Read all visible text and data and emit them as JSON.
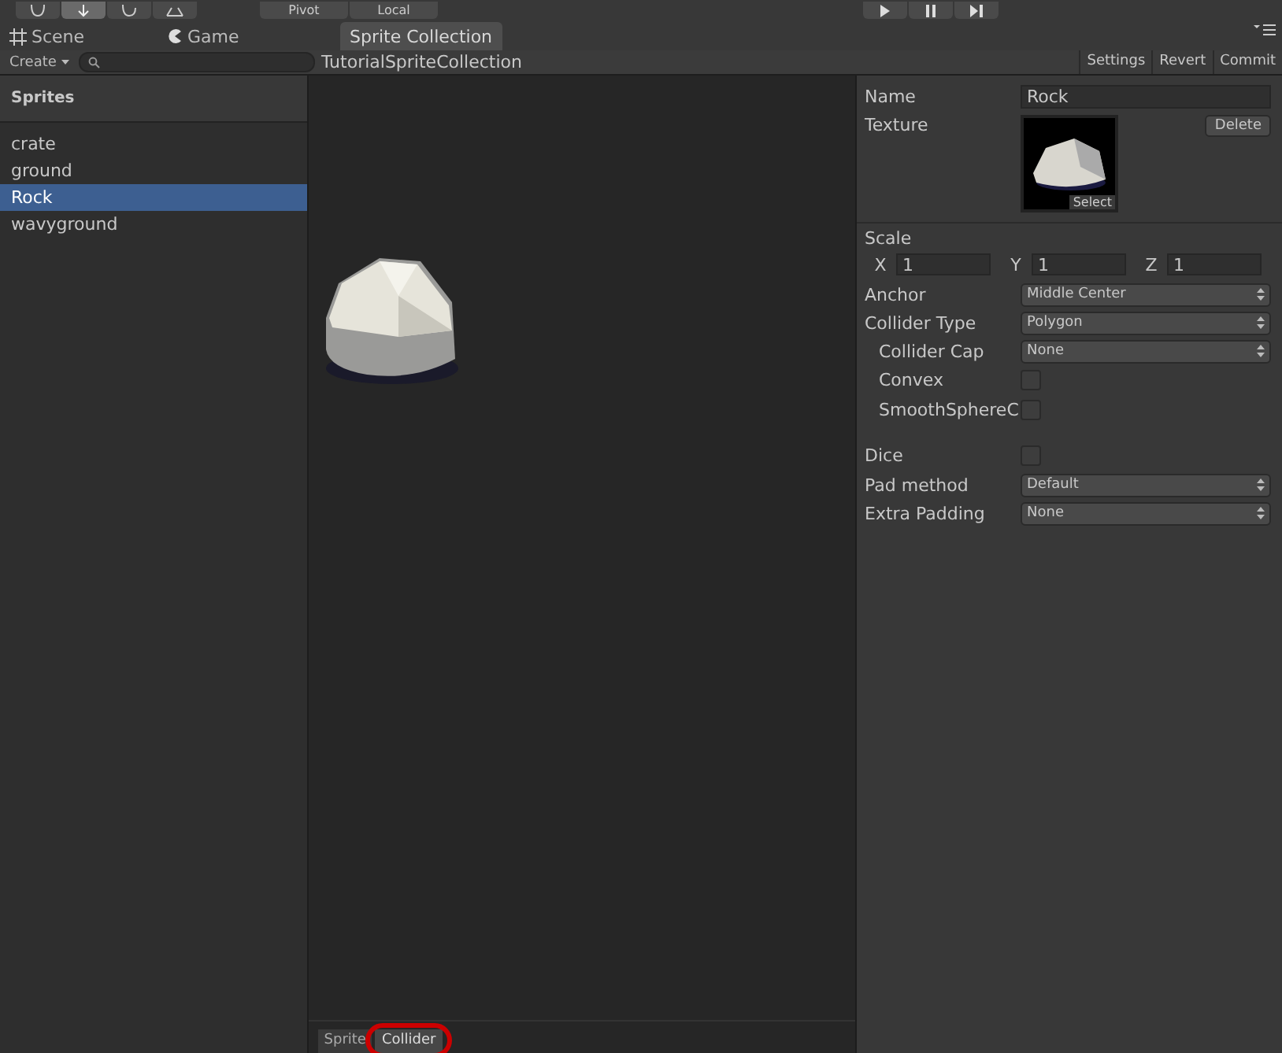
{
  "toolbar": {
    "pivot": "Pivot",
    "local": "Local"
  },
  "tabs": [
    {
      "label": "Scene",
      "selected": false
    },
    {
      "label": "Game",
      "selected": false
    },
    {
      "label": "Sprite Collection",
      "selected": true
    }
  ],
  "collection_bar": {
    "create": "Create",
    "collection_name": "TutorialSpriteCollection",
    "buttons": [
      "Settings",
      "Revert",
      "Commit"
    ]
  },
  "sidebar": {
    "title": "Sprites",
    "items": [
      {
        "label": "crate",
        "selected": false
      },
      {
        "label": "ground",
        "selected": false
      },
      {
        "label": "Rock",
        "selected": true
      },
      {
        "label": "wavyground",
        "selected": false
      }
    ]
  },
  "inspector": {
    "name": {
      "label": "Name",
      "value": "Rock"
    },
    "texture": {
      "label": "Texture",
      "select": "Select",
      "delete": "Delete"
    },
    "scale": {
      "label": "Scale",
      "axes": [
        {
          "axis": "X",
          "value": "1"
        },
        {
          "axis": "Y",
          "value": "1"
        },
        {
          "axis": "Z",
          "value": "1"
        }
      ]
    },
    "row_groups": [
      [
        {
          "kind": "dropdown",
          "label": "Anchor",
          "value": "Middle Center",
          "indented": false
        },
        {
          "kind": "dropdown",
          "label": "Collider Type",
          "value": "Polygon",
          "indented": false
        },
        {
          "kind": "dropdown",
          "label": "Collider Cap",
          "value": "None",
          "indented": true
        },
        {
          "kind": "checkbox",
          "label": "Convex",
          "checked": false,
          "indented": true
        },
        {
          "kind": "checkbox",
          "label": "SmoothSphereC",
          "checked": false,
          "indented": true
        }
      ],
      [
        {
          "kind": "checkbox",
          "label": "Dice",
          "checked": false,
          "indented": false
        },
        {
          "kind": "dropdown",
          "label": "Pad method",
          "value": "Default",
          "indented": false
        },
        {
          "kind": "dropdown",
          "label": "Extra Padding",
          "value": "None",
          "indented": false
        }
      ]
    ]
  },
  "bottom_tabs": [
    {
      "label": "Sprite",
      "selected": false,
      "circled": false
    },
    {
      "label": "Collider",
      "selected": true,
      "circled": true
    }
  ]
}
